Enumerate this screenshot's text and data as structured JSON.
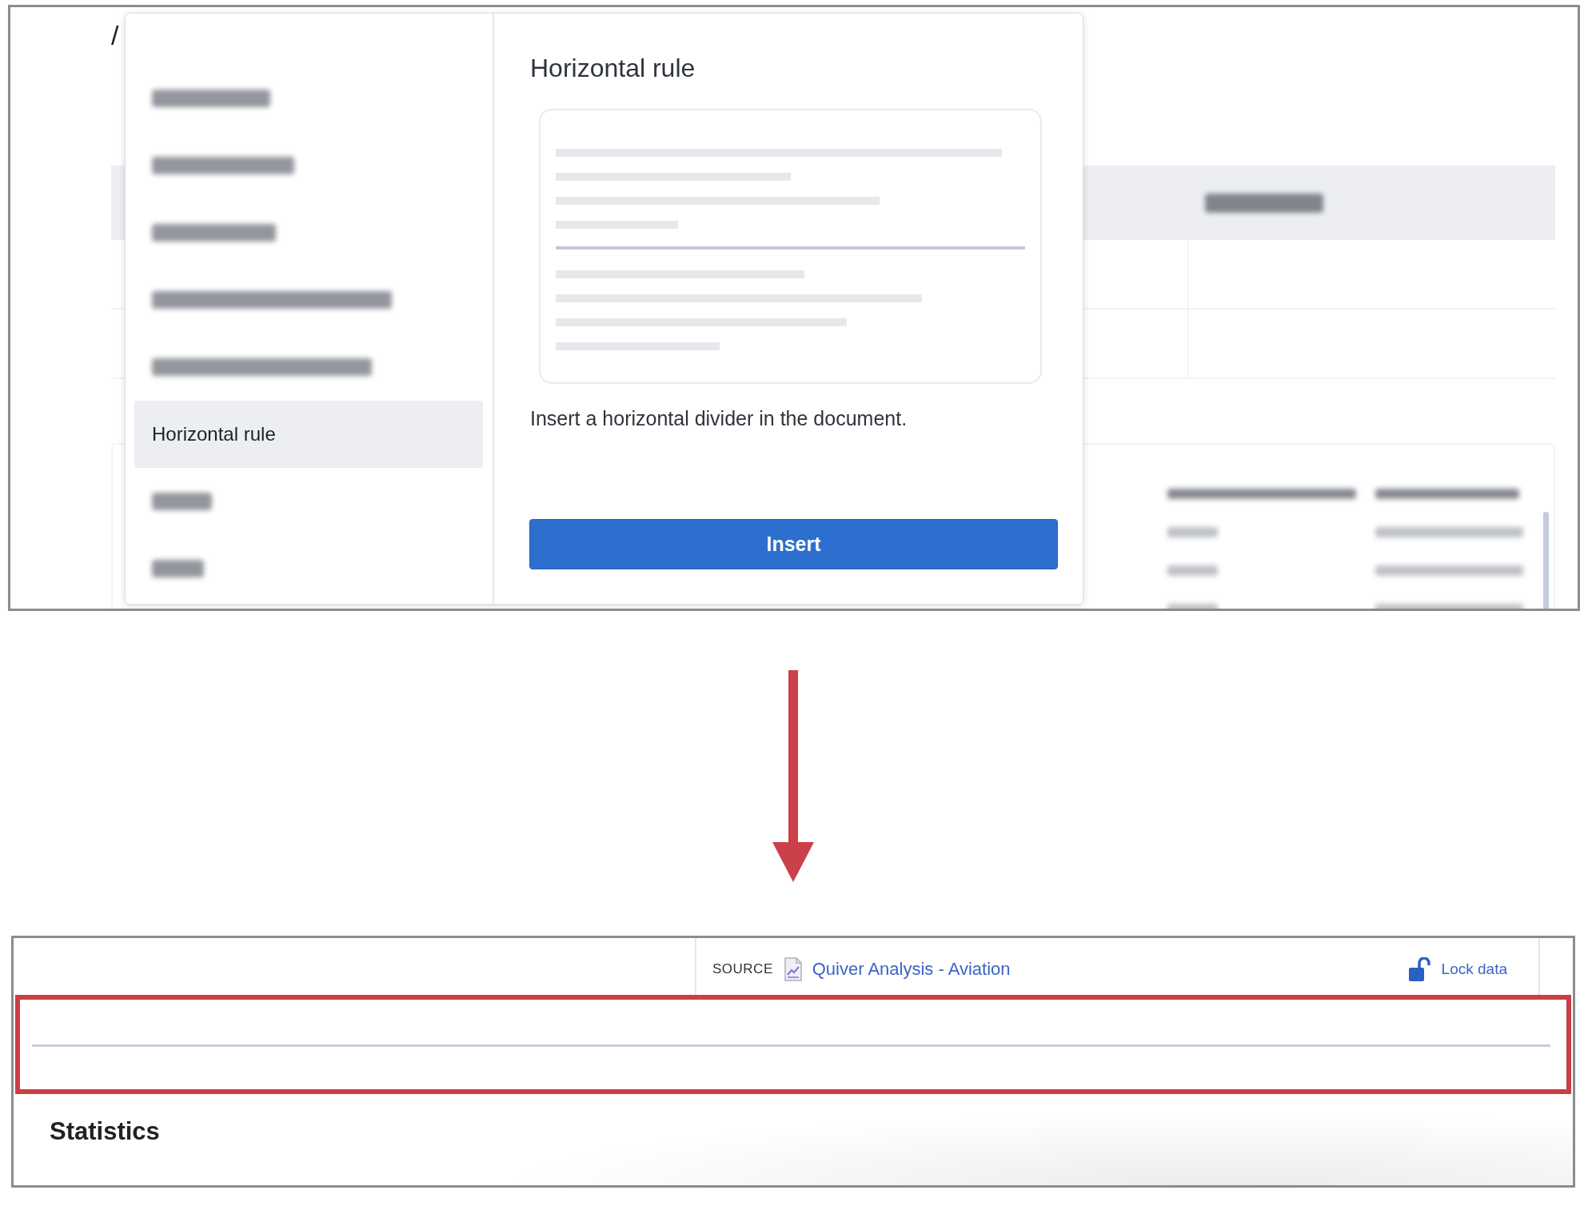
{
  "top_screenshot": {
    "breadcrumb_separator": "/",
    "background": {
      "blurred": true
    },
    "insert_menu": {
      "items": [
        {
          "kind": "blurred",
          "selected": false
        },
        {
          "kind": "blurred",
          "selected": false
        },
        {
          "kind": "blurred",
          "selected": false
        },
        {
          "kind": "blurred",
          "selected": false
        },
        {
          "kind": "blurred",
          "selected": false
        },
        {
          "kind": "text",
          "label": "Horizontal rule",
          "selected": true
        },
        {
          "kind": "blurred",
          "selected": false
        },
        {
          "kind": "blurred",
          "selected": false
        }
      ]
    },
    "preview": {
      "title": "Horizontal rule",
      "description": "Insert a horizontal divider in the document.",
      "button": "Insert"
    }
  },
  "bottom_screenshot": {
    "source_label": "SOURCE",
    "source_link": "Quiver Analysis - Aviation",
    "lock_button": "Lock data",
    "locked": false,
    "divider_highlighted": true,
    "heading": "Statistics"
  }
}
